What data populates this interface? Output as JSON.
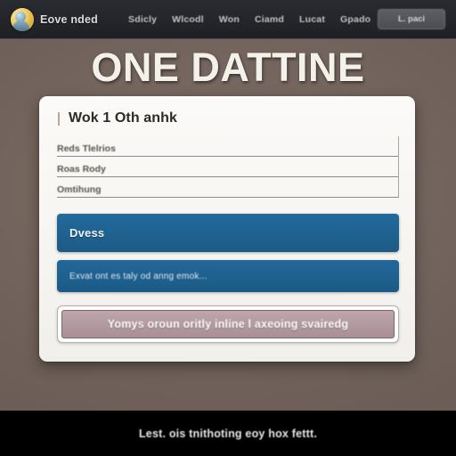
{
  "topbar": {
    "logo_icon": "circular-avatar-badge-icon",
    "brand": "Eove nded",
    "nav_items": [
      {
        "label": "Sdicly"
      },
      {
        "label": "Wlcodl"
      },
      {
        "label": "Won"
      },
      {
        "label": "Ciamd"
      },
      {
        "label": "Lucat"
      },
      {
        "label": "Gpado"
      }
    ],
    "login_label": "L. paci"
  },
  "hero": {
    "headline": "ONE DATTINE"
  },
  "card": {
    "title": "Wok 1 Oth anhk",
    "fields": [
      {
        "label": "Reds Tlelrios",
        "value": ""
      },
      {
        "label": "Roas Rody",
        "value": ""
      },
      {
        "label": "Omtihung",
        "value": ""
      }
    ],
    "primary_bar_label": "Dvess",
    "secondary_bar_label": "Exvat ont es taly od anng emok...",
    "notice_text": "Yomys oroun oritly inline l axeoing svairedg"
  },
  "footer": {
    "text": "Lest. ois tnithoting eoy hox fettt."
  },
  "colors": {
    "page_background": "#6f6159",
    "topbar_background": "#24252a",
    "card_background": "#f7f6f4",
    "accent_blue": "#1d5c88",
    "notice_rose": "#b2999f",
    "footer_background": "#000000",
    "headline_text": "#f4f1ea",
    "logo_gold": "#d6a935"
  }
}
